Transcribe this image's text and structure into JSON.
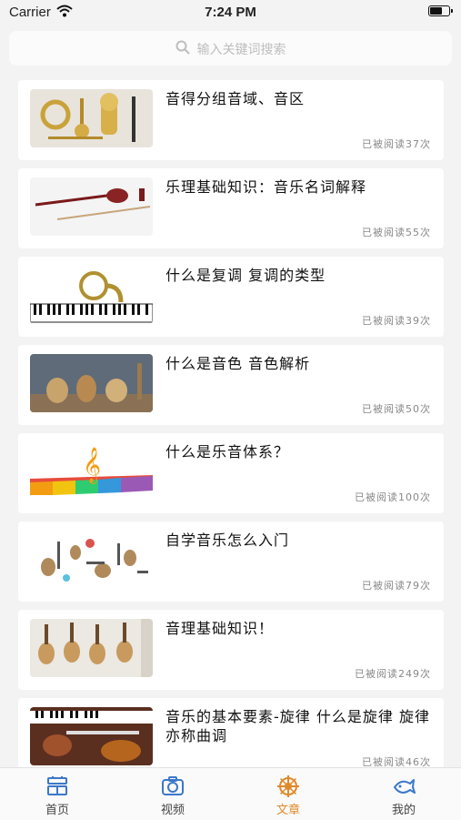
{
  "status": {
    "carrier": "Carrier",
    "time": "7:24 PM"
  },
  "search": {
    "placeholder": "输入关键词搜索"
  },
  "articles": [
    {
      "title": "音得分组音域、音区",
      "reads": "已被阅读37次",
      "thumb": "brass-instruments"
    },
    {
      "title": "乐理基础知识：音乐名词解释",
      "reads": "已被阅读55次",
      "thumb": "erhu"
    },
    {
      "title": "什么是复调 复调的类型",
      "reads": "已被阅读39次",
      "thumb": "horn-piano"
    },
    {
      "title": "什么是音色 音色解析",
      "reads": "已被阅读50次",
      "thumb": "string-instruments-display"
    },
    {
      "title": "什么是乐音体系？",
      "reads": "已被阅读100次",
      "thumb": "treble-clef-keyboard"
    },
    {
      "title": "自学音乐怎么入门",
      "reads": "已被阅读79次",
      "thumb": "assorted-instruments"
    },
    {
      "title": "音理基础知识！",
      "reads": "已被阅读249次",
      "thumb": "guitar-wall"
    },
    {
      "title": "音乐的基本要素-旋律 什么是旋律 旋律亦称曲调",
      "reads": "已被阅读46次",
      "thumb": "violin-piano"
    }
  ],
  "tabs": [
    {
      "label": "首页",
      "icon": "home-icon"
    },
    {
      "label": "视频",
      "icon": "camera-icon"
    },
    {
      "label": "文章",
      "icon": "wheel-icon",
      "active": true
    },
    {
      "label": "我的",
      "icon": "fish-icon"
    }
  ],
  "colors": {
    "active_tab": "#e08a2b",
    "inactive_icon": "#3a78c9"
  }
}
